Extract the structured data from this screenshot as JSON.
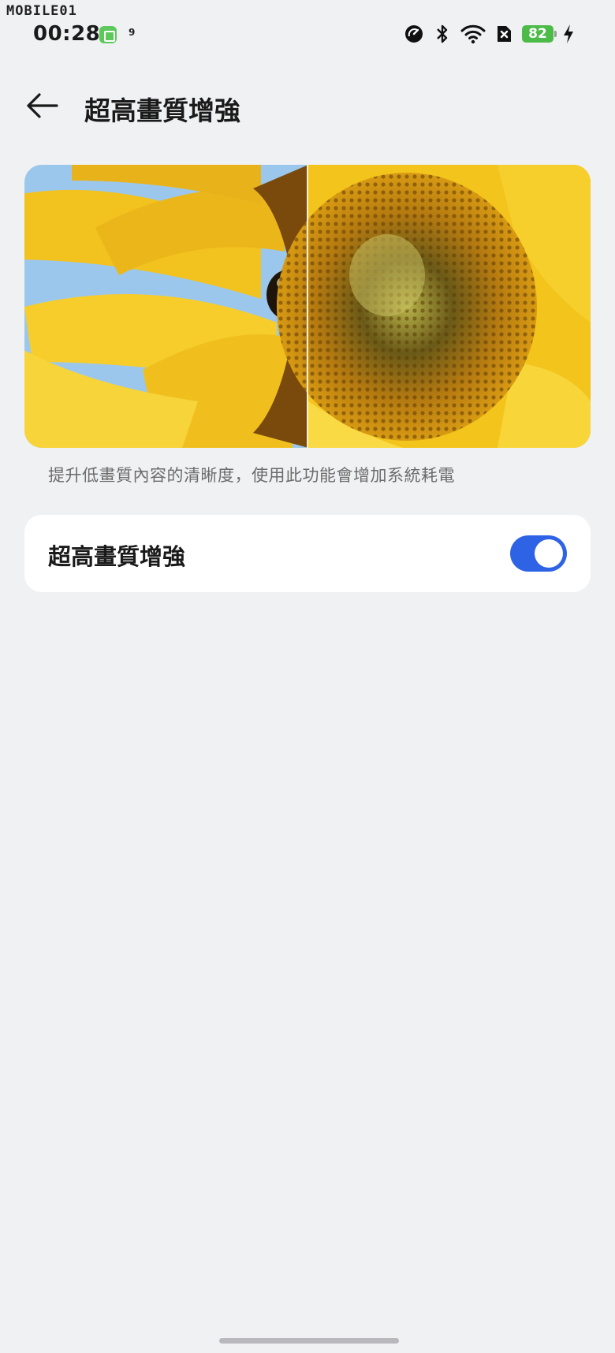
{
  "watermark": "MOBILE01",
  "status_bar": {
    "time": "00:28",
    "notification_count": "9",
    "battery_level": "82",
    "icons": [
      "data-saver-icon",
      "bluetooth-icon",
      "wifi-icon",
      "no-sim-icon",
      "battery-icon",
      "charging-icon"
    ]
  },
  "header": {
    "back_icon": "arrow-left-icon",
    "title": "超高畫質增強"
  },
  "preview": {
    "image": "sunflower-comparison",
    "description": "提升低畫質內容的清晰度，使用此功能會增加系統耗電"
  },
  "setting": {
    "label": "超高畫質增強",
    "enabled": true
  },
  "colors": {
    "background": "#f0f1f3",
    "card": "#ffffff",
    "toggle_on": "#2f63e6",
    "battery": "#4dbb48"
  }
}
